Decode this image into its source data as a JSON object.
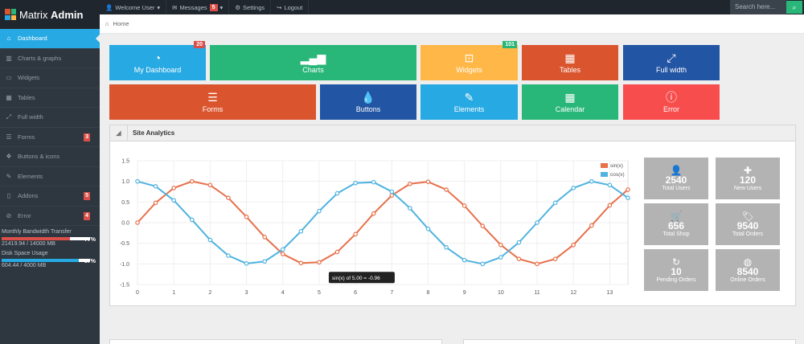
{
  "brand": {
    "name_light": "Matrix",
    "name_bold": "Admin"
  },
  "topnav": {
    "items": [
      {
        "icon": "user-icon",
        "glyph": "👤",
        "label": "Welcome User",
        "caret": true
      },
      {
        "icon": "envelope-icon",
        "glyph": "✉",
        "label": "Messages",
        "badge": "5",
        "caret": true
      },
      {
        "icon": "gear-icon",
        "glyph": "⚙",
        "label": "Settings"
      },
      {
        "icon": "logout-icon",
        "glyph": "↪",
        "label": "Logout"
      }
    ],
    "search_placeholder": "Search here..."
  },
  "sidebar": {
    "items": [
      {
        "label": "Dashboard",
        "icon": "home-icon",
        "glyph": "⌂",
        "active": true
      },
      {
        "label": "Charts & graphs",
        "icon": "bar-chart-icon",
        "glyph": "▥"
      },
      {
        "label": "Widgets",
        "icon": "inbox-icon",
        "glyph": "▭"
      },
      {
        "label": "Tables",
        "icon": "table-icon",
        "glyph": "▦"
      },
      {
        "label": "Full width",
        "icon": "fullscreen-icon",
        "glyph": "⤢"
      },
      {
        "label": "Forms",
        "icon": "list-icon",
        "glyph": "☰",
        "badge": "3"
      },
      {
        "label": "Buttons & icons",
        "icon": "tint-icon",
        "glyph": "❖"
      },
      {
        "label": "Elements",
        "icon": "pencil-icon",
        "glyph": "✎"
      },
      {
        "label": "Addons",
        "icon": "file-icon",
        "glyph": "▯",
        "badge": "5"
      },
      {
        "label": "Error",
        "icon": "info-icon",
        "glyph": "⊘",
        "badge": "4"
      }
    ],
    "usage": [
      {
        "label": "Monthly Bandwidth Transfer",
        "value": "21419.94 / 14000 MB",
        "percent": "77%",
        "fill": 0.77,
        "color": "#da4f49"
      },
      {
        "label": "Disk Space Usage",
        "value": "604.44 / 4000 MB",
        "percent": "87%",
        "fill": 0.87,
        "color": "#27a9e3"
      }
    ]
  },
  "breadcrumb": {
    "icon": "home-icon",
    "label": "Home"
  },
  "tiles": [
    {
      "label": "My Dashboard",
      "icon": "dashboard-icon",
      "glyph": "◔",
      "color": "#27a9e3",
      "badge": "20",
      "badge_color": "#da4f49"
    },
    {
      "label": "Charts",
      "icon": "signal-icon",
      "glyph": "▂▄▆",
      "color": "#28b779"
    },
    {
      "label": "Widgets",
      "icon": "inbox-icon",
      "glyph": "⊡",
      "color": "#ffb848",
      "badge": "101",
      "badge_color": "#28b779"
    },
    {
      "label": "Tables",
      "icon": "table-icon",
      "glyph": "▦",
      "color": "#da542e"
    },
    {
      "label": "Full width",
      "icon": "fullscreen-icon",
      "glyph": "⤢",
      "color": "#2255a4"
    },
    {
      "label": "Forms",
      "icon": "list-icon",
      "glyph": "☰",
      "color": "#da542e"
    },
    {
      "label": "Buttons",
      "icon": "tint-icon",
      "glyph": "💧",
      "color": "#2255a4"
    },
    {
      "label": "Elements",
      "icon": "pencil-icon",
      "glyph": "✎",
      "color": "#27a9e3"
    },
    {
      "label": "Calendar",
      "icon": "calendar-icon",
      "glyph": "▦",
      "color": "#28b779"
    },
    {
      "label": "Error",
      "icon": "info-icon",
      "glyph": "ⓘ",
      "color": "#f74d4d"
    }
  ],
  "widget": {
    "title": "Site Analytics",
    "tooltip": "sin(x) of 5.00 = -0.96"
  },
  "stats": [
    {
      "value": "2540",
      "label": "Total Users",
      "icon": "user-icon",
      "glyph": "👤"
    },
    {
      "value": "120",
      "label": "New Users",
      "icon": "plus-icon",
      "glyph": "✚"
    },
    {
      "value": "656",
      "label": "Total Shop",
      "icon": "cart-icon",
      "glyph": "🛒"
    },
    {
      "value": "9540",
      "label": "Total Orders",
      "icon": "tag-icon",
      "glyph": "🏷"
    },
    {
      "value": "10",
      "label": "Pending Orders",
      "icon": "repeat-icon",
      "glyph": "↻"
    },
    {
      "value": "8540",
      "label": "Online Orders",
      "icon": "globe-icon",
      "glyph": "◍"
    }
  ],
  "chart_data": {
    "type": "line",
    "title": "",
    "xlabel": "",
    "ylabel": "",
    "xlim": [
      0,
      13.5
    ],
    "ylim": [
      -1.5,
      1.5
    ],
    "x_ticks": [
      0,
      1,
      2,
      3,
      4,
      5,
      6,
      7,
      8,
      9,
      10,
      11,
      12,
      13
    ],
    "y_ticks": [
      1.5,
      1.0,
      0.5,
      0.0,
      -0.5,
      -1.0,
      -1.5
    ],
    "grid": true,
    "legend_position": "top-right",
    "x": [
      0,
      0.5,
      1,
      1.5,
      2,
      2.5,
      3,
      3.5,
      4,
      4.5,
      5,
      5.5,
      6,
      6.5,
      7,
      7.5,
      8,
      8.5,
      9,
      9.5,
      10,
      10.5,
      11,
      11.5,
      12,
      12.5,
      13,
      13.5
    ],
    "series": [
      {
        "name": "sin(x)",
        "color": "#e8704a",
        "values": [
          0.0,
          0.48,
          0.84,
          1.0,
          0.91,
          0.6,
          0.14,
          -0.35,
          -0.76,
          -0.98,
          -0.96,
          -0.71,
          -0.28,
          0.22,
          0.66,
          0.94,
          0.99,
          0.8,
          0.41,
          -0.08,
          -0.54,
          -0.88,
          -1.0,
          -0.88,
          -0.54,
          -0.07,
          0.42,
          0.8
        ]
      },
      {
        "name": "cos(x)",
        "color": "#4fb3e0",
        "values": [
          1.0,
          0.88,
          0.54,
          0.07,
          -0.42,
          -0.8,
          -0.99,
          -0.94,
          -0.65,
          -0.21,
          0.28,
          0.71,
          0.96,
          0.98,
          0.75,
          0.35,
          -0.15,
          -0.6,
          -0.91,
          -1.0,
          -0.84,
          -0.48,
          0.0,
          0.48,
          0.84,
          1.0,
          0.91,
          0.6
        ]
      }
    ]
  }
}
